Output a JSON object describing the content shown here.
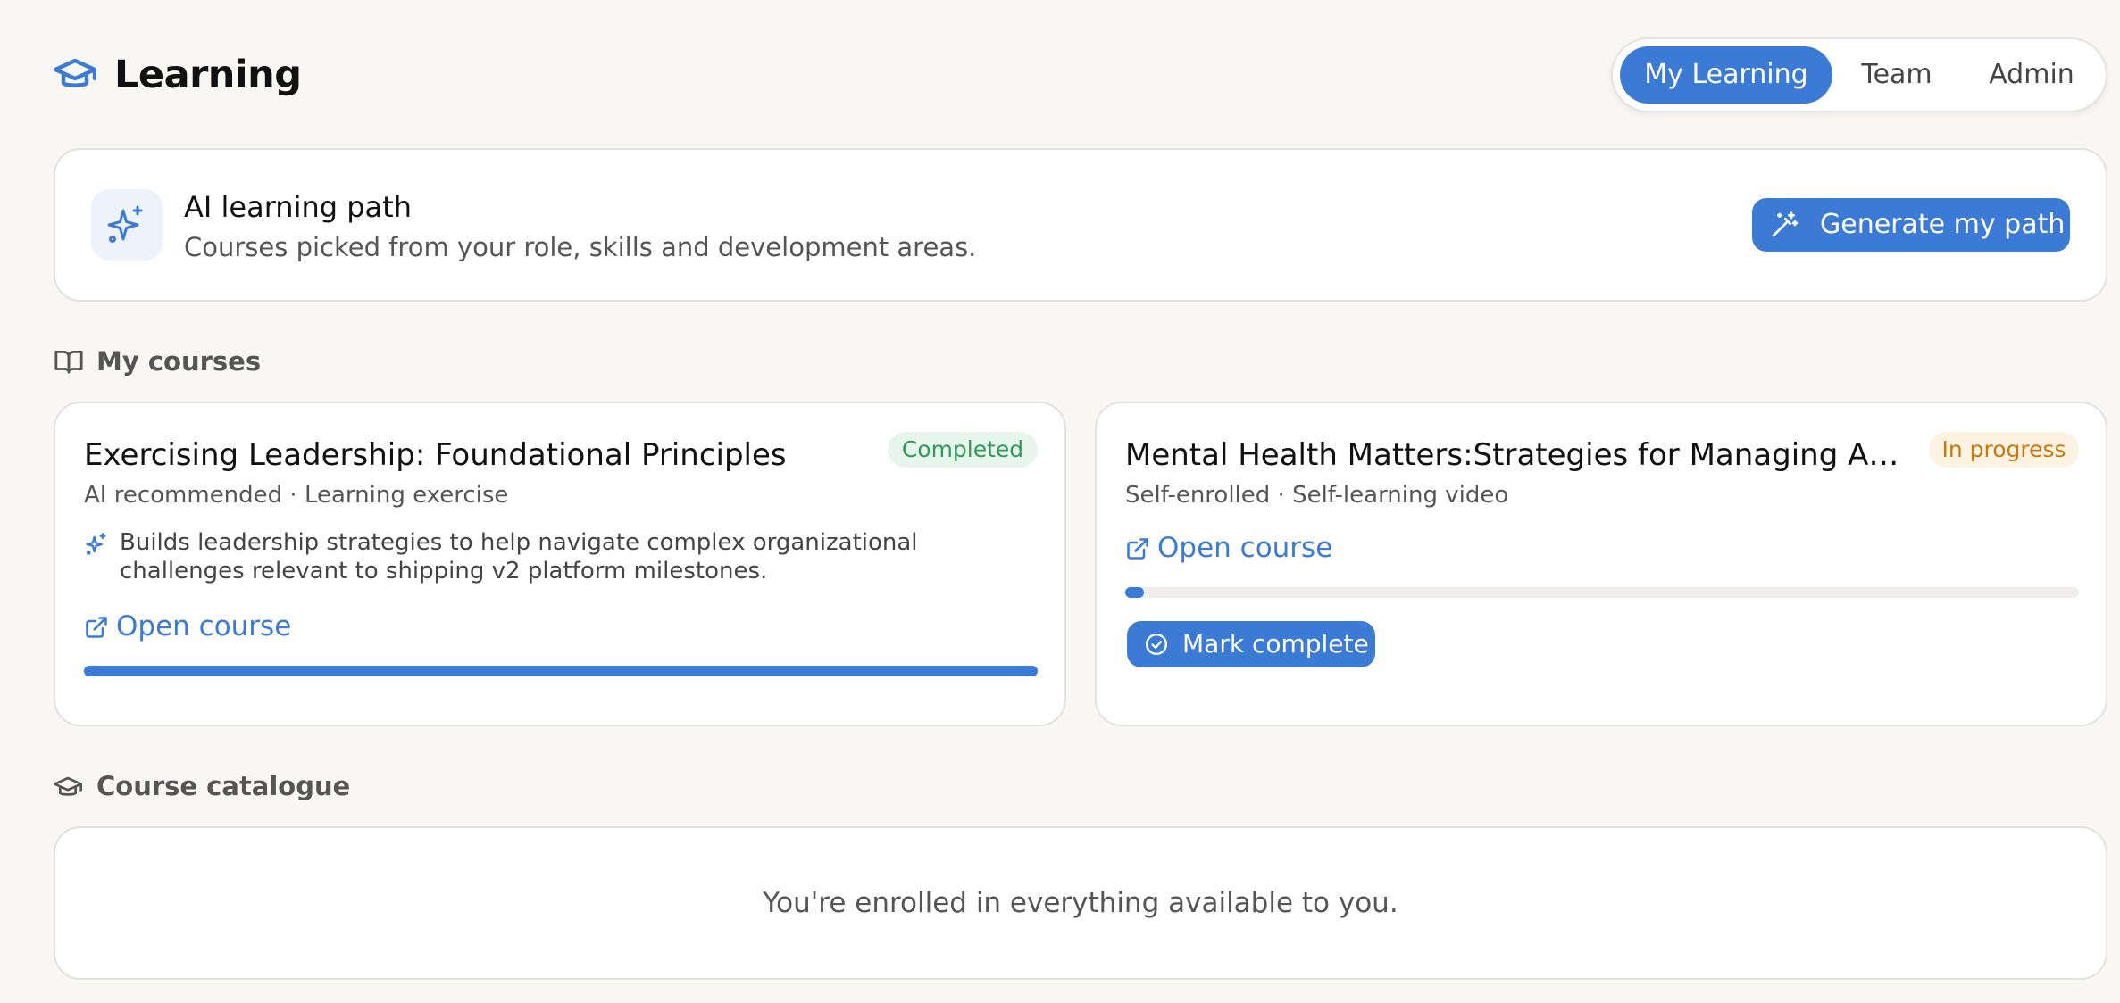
{
  "header": {
    "title": "Learning",
    "title_icon": "graduation-cap-icon",
    "tabs": [
      {
        "label": "My Learning",
        "active": true
      },
      {
        "label": "Team",
        "active": false
      },
      {
        "label": "Admin",
        "active": false
      }
    ]
  },
  "ai_path": {
    "icon": "sparkles-icon",
    "title": "AI learning path",
    "subtitle": "Courses picked from your role, skills and development areas.",
    "button_label": "Generate my path",
    "button_icon": "magic-wand-icon"
  },
  "my_courses": {
    "heading": "My courses",
    "heading_icon": "open-book-icon",
    "courses": [
      {
        "title": "Exercising Leadership: Foundational Principles",
        "status": "Completed",
        "meta": "AI recommended · Learning exercise",
        "reason": "Builds leadership strategies to help navigate complex organizational challenges relevant to shipping v2 platform milestones.",
        "open_label": "Open course",
        "progress": 1.0
      },
      {
        "title": "Mental Health Matters:Strategies for Managing Anxiety",
        "status": "In progress",
        "meta": "Self-enrolled · Self-learning video",
        "open_label": "Open course",
        "progress": 0.02,
        "action_label": "Mark complete"
      }
    ]
  },
  "catalogue": {
    "heading": "Course catalogue",
    "heading_icon": "graduation-cap-icon",
    "empty_message": "You're enrolled in everything available to you."
  },
  "colors": {
    "accent": "#3b7bd6",
    "completed_text": "#2f9a5a",
    "completed_bg": "#e8f5ec",
    "in_progress_text": "#c77a12",
    "in_progress_bg": "#fdf3e3",
    "background": "#f8f7f4"
  }
}
